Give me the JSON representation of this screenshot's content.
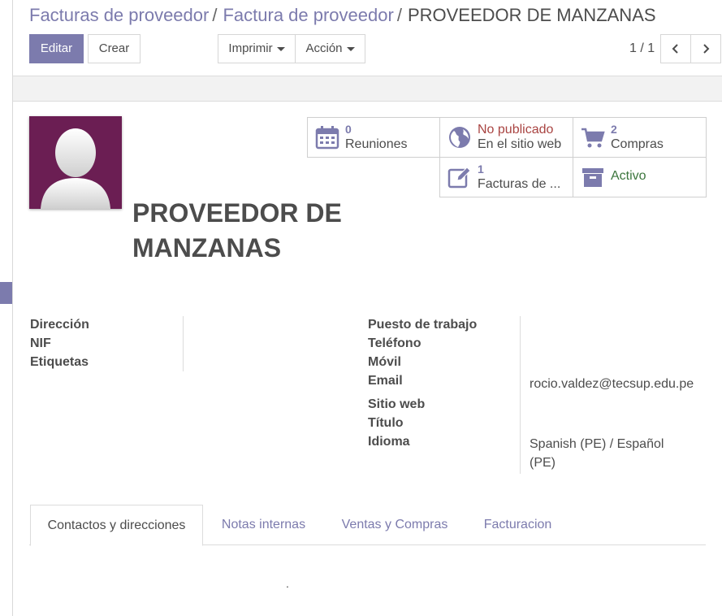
{
  "breadcrumb": {
    "items": [
      "Facturas de proveedor",
      "Factura de proveedor"
    ],
    "separator": "/",
    "current": "PROVEEDOR DE MANZANAS"
  },
  "toolbar": {
    "edit_label": "Editar",
    "create_label": "Crear",
    "print_label": "Imprimir",
    "action_label": "Acción"
  },
  "pager": {
    "value": "1 / 1"
  },
  "partner": {
    "name": "PROVEEDOR DE MANZANAS"
  },
  "smart_buttons": {
    "meetings": {
      "value": "0",
      "label": "Reuniones"
    },
    "website": {
      "value": "No publicado",
      "label": "En el sitio web"
    },
    "purchases": {
      "value": "2",
      "label": "Compras"
    },
    "bills": {
      "value": "1",
      "label": "Facturas de ..."
    },
    "active": {
      "label": "Activo"
    }
  },
  "fields_left": [
    "Dirección",
    "NIF",
    "Etiquetas"
  ],
  "fields_right": {
    "job": "Puesto de trabajo",
    "phone": "Teléfono",
    "mobile": "Móvil",
    "email": "Email",
    "website": "Sitio web",
    "title": "Título",
    "language": "Idioma"
  },
  "values": {
    "email": "rocio.valdez@tecsup.edu.pe",
    "language": "Spanish (PE) / Español (PE)"
  },
  "tabs": [
    "Contactos y direcciones",
    "Notas internas",
    "Ventas y Compras",
    "Facturacion"
  ],
  "dot_text": ".",
  "colors": {
    "primary": "#7c7bad",
    "avatar_bg": "#6b1e53",
    "unpublished": "#a94442",
    "active": "#3c763d"
  }
}
